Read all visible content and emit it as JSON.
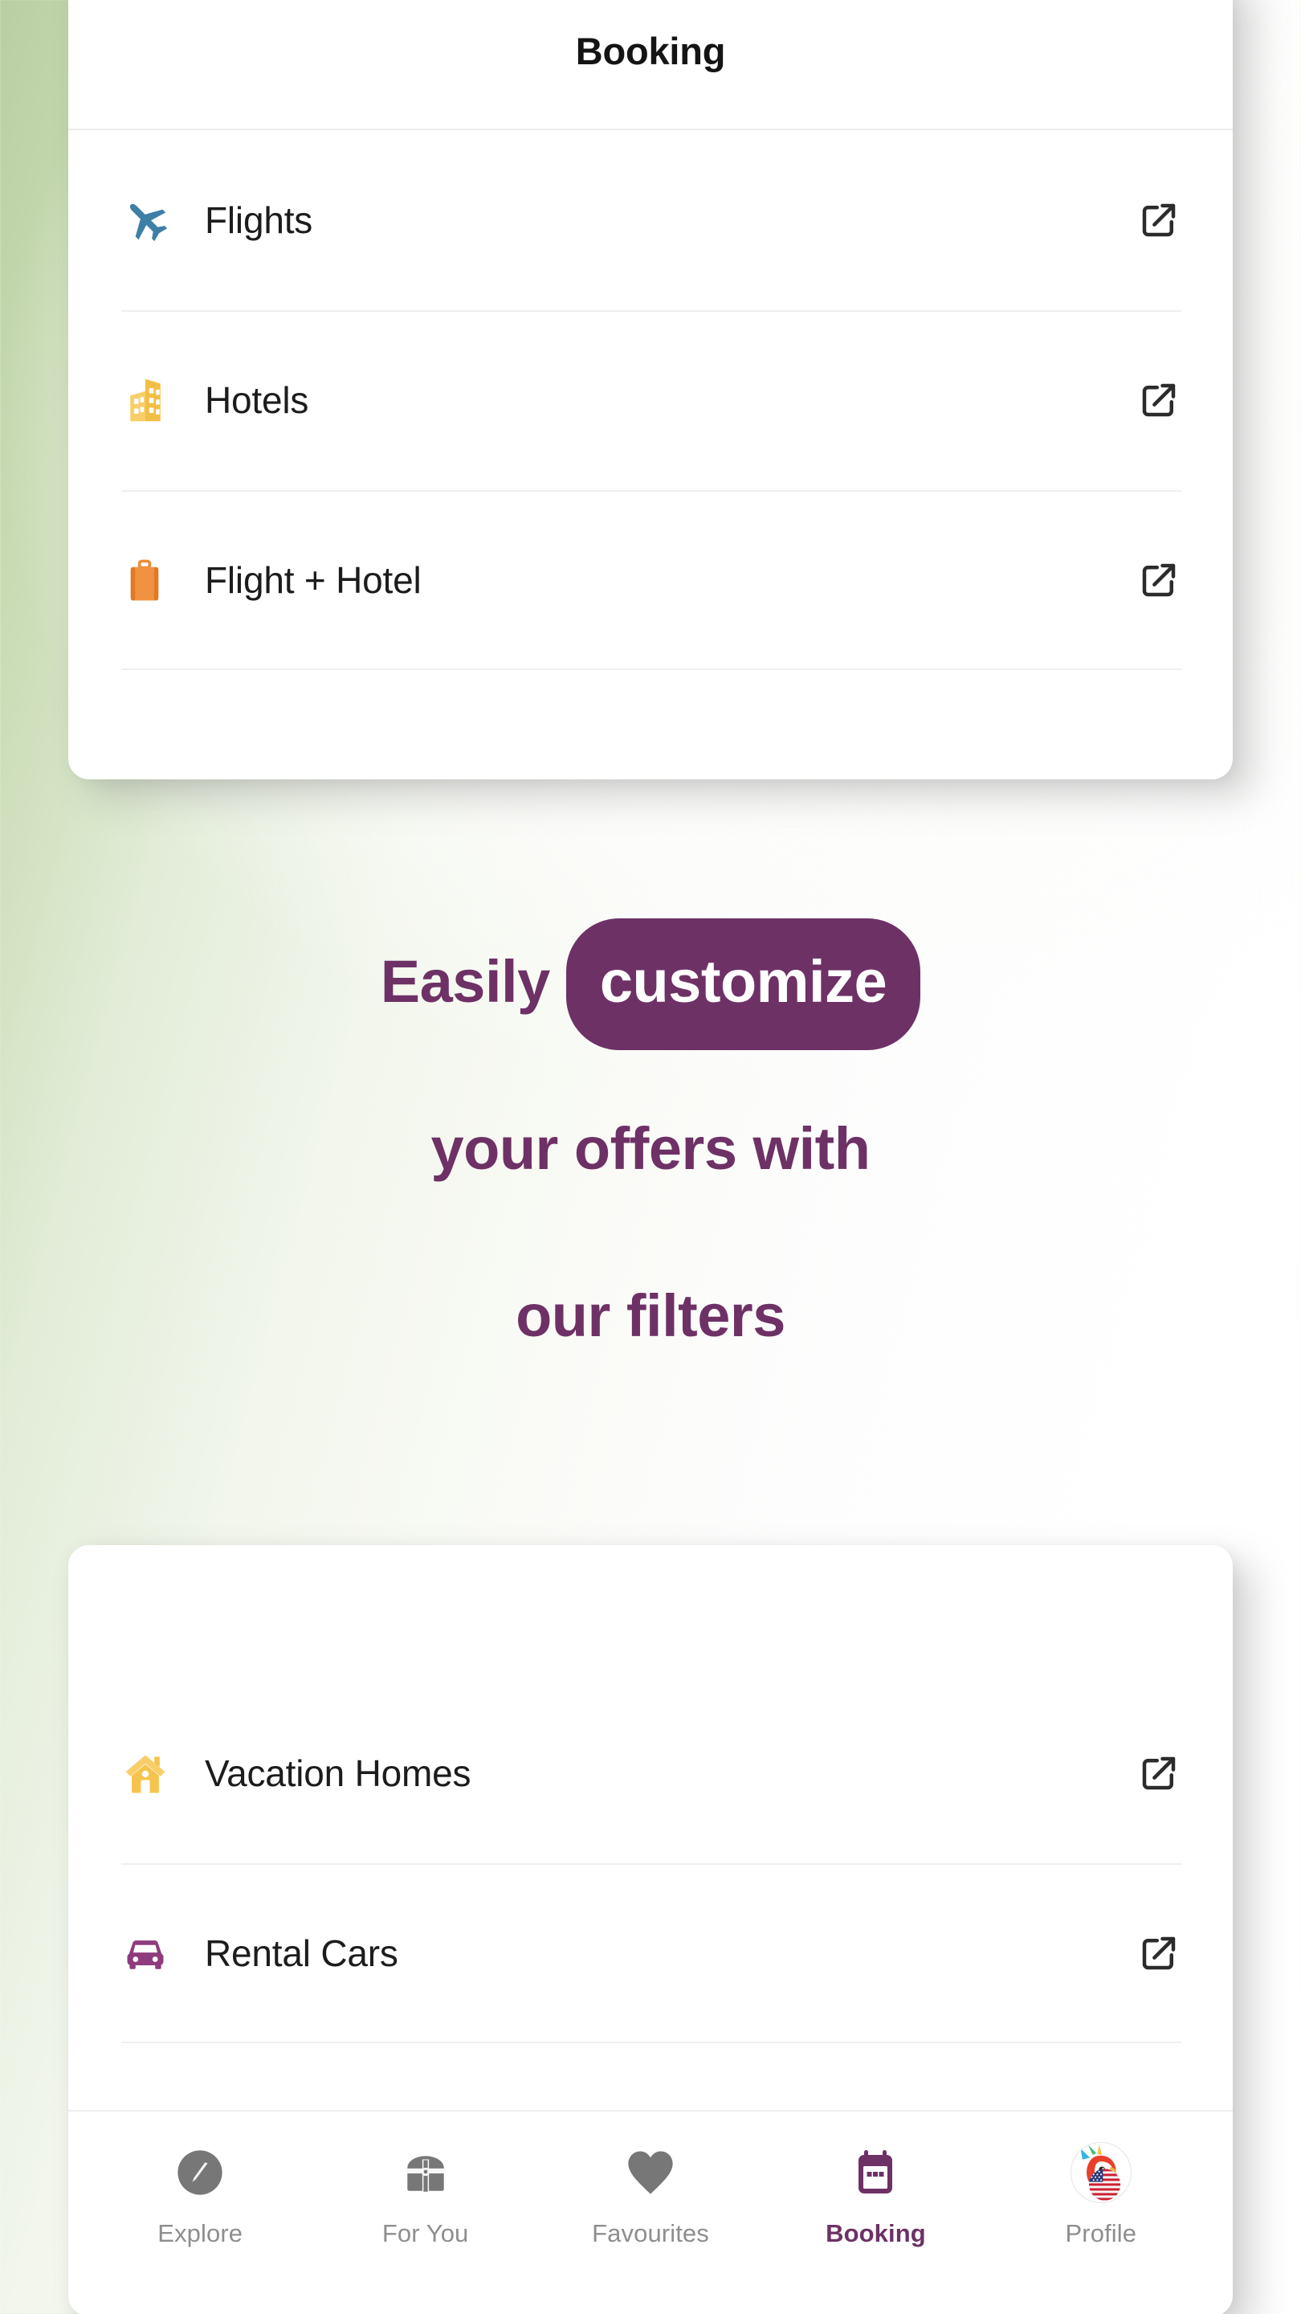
{
  "app": {
    "accent_purple": "#6E3166",
    "background_green": "#BACFA3"
  },
  "header": {
    "title": "Booking"
  },
  "booking_options_top": [
    {
      "label": "Flights",
      "icon": "airplane-icon",
      "icon_color": "#3E7FA6",
      "action_icon": "external-link-icon"
    },
    {
      "label": "Hotels",
      "icon": "building-icon",
      "icon_color": "#F5C24C",
      "action_icon": "external-link-icon"
    },
    {
      "label": "Flight + Hotel",
      "icon": "suitcase-icon",
      "icon_color": "#EE8B37",
      "action_icon": "external-link-icon"
    }
  ],
  "headline": {
    "line1_prefix": "Easily",
    "line1_highlight": "customize",
    "line2": "your offers with",
    "line3": "our filters"
  },
  "booking_options_bottom": [
    {
      "label": "Vacation Homes",
      "icon": "house-icon",
      "icon_color": "#F8C651",
      "action_icon": "external-link-icon"
    },
    {
      "label": "Rental Cars",
      "icon": "car-icon",
      "icon_color": "#8E3C7E",
      "action_icon": "external-link-icon"
    }
  ],
  "bottom_nav": {
    "items": [
      {
        "label": "Explore",
        "icon": "compass-icon",
        "active": false
      },
      {
        "label": "For You",
        "icon": "treasure-chest-icon",
        "active": false
      },
      {
        "label": "Favourites",
        "icon": "heart-icon",
        "active": false
      },
      {
        "label": "Booking",
        "icon": "calendar-icon",
        "active": true
      },
      {
        "label": "Profile",
        "icon": "avatar-parrot-flag-icon",
        "active": false
      }
    ]
  }
}
